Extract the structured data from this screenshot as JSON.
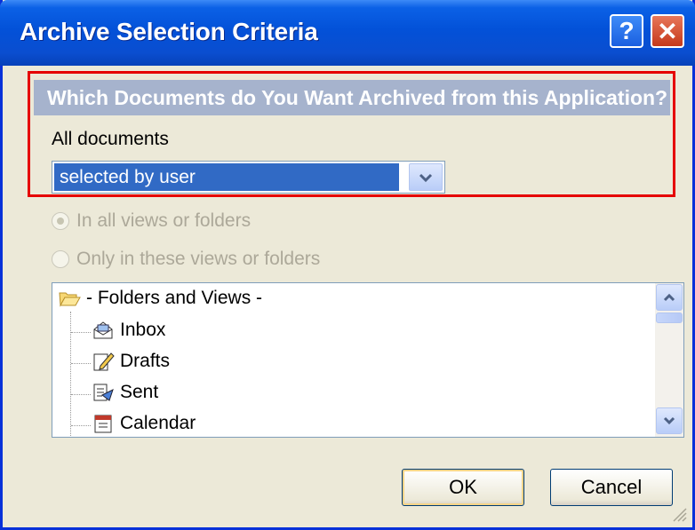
{
  "window": {
    "title": "Archive Selection Criteria",
    "help_label": "?",
    "close_label": "✕"
  },
  "section": {
    "heading": "Which Documents do You Want Archived from this Application?"
  },
  "documents": {
    "label": "All documents",
    "select_value": "selected by user"
  },
  "scope": {
    "options": [
      {
        "label": "In all views or folders",
        "selected": true,
        "enabled": false
      },
      {
        "label": "Only in these views or folders",
        "selected": false,
        "enabled": false
      }
    ]
  },
  "tree": {
    "root": {
      "label": "- Folders and Views -",
      "icon": "open-folder-icon"
    },
    "items": [
      {
        "label": "Inbox",
        "icon": "inbox-icon"
      },
      {
        "label": "Drafts",
        "icon": "drafts-icon"
      },
      {
        "label": "Sent",
        "icon": "sent-icon"
      },
      {
        "label": "Calendar",
        "icon": "calendar-icon"
      }
    ]
  },
  "buttons": {
    "ok": "OK",
    "cancel": "Cancel"
  },
  "colors": {
    "title_bar": "#0351d8",
    "highlight_border": "#e50000",
    "section_bar": "#a6b3cd",
    "selection": "#316ac5"
  }
}
